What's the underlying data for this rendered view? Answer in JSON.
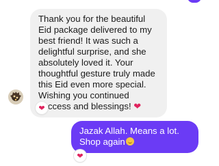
{
  "conversation": {
    "incoming": {
      "text": "Thank you for the beautiful Eid package delivered to my best friend! It was such a delightful surprise, and she absolutely loved it. Your thoughtful gesture truly made this Eid even more special. Wishing you continued success and blessings!",
      "inline_emoji": "❤",
      "reaction": "❤"
    },
    "outgoing": {
      "text": "Jazak Allah. Means a lot. Shop again",
      "inline_emoji_icon": "grinning-face-icon",
      "reaction": "❤"
    }
  },
  "colors": {
    "outgoing_bubble": "#6b3bf5",
    "incoming_bubble": "#f0f0f0",
    "heart": "#e0245e"
  }
}
